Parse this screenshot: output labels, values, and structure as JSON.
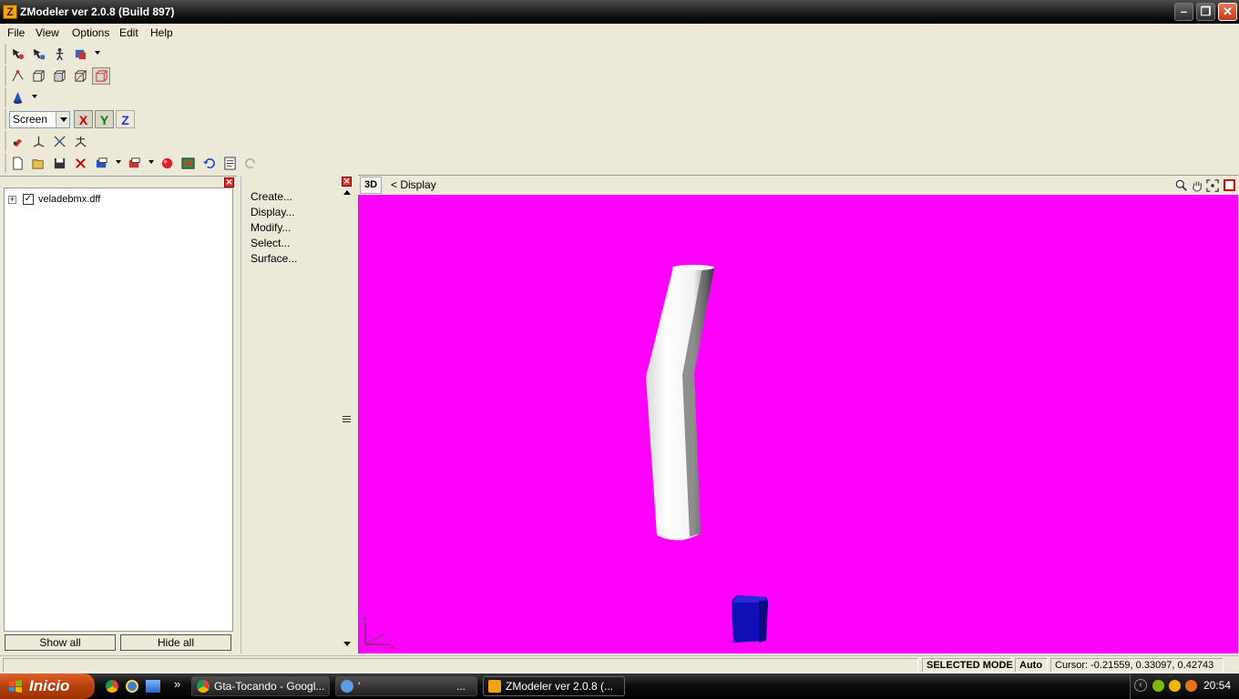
{
  "window": {
    "title": "ZModeler ver 2.0.8 (Build 897)",
    "logo_letter": "Z"
  },
  "menu": [
    "File",
    "View",
    "Options",
    "Edit",
    "Help"
  ],
  "toolbar": {
    "coord_select": "Screen",
    "axis_x": "X",
    "axis_y": "Y",
    "axis_z": "Z"
  },
  "tree": {
    "item": "veladebmx.dff",
    "checked": "✓",
    "expand": "+"
  },
  "left_buttons": {
    "show_all": "Show all",
    "hide_all": "Hide all"
  },
  "commands": [
    "Create...",
    "Display...",
    "Modify...",
    "Select...",
    "Surface..."
  ],
  "viewport": {
    "mode": "3D",
    "breadcrumb": "< Display",
    "background": "#ff00ff",
    "axis_y": "y",
    "axis_x": "x"
  },
  "status": {
    "mode": "SELECTED MODE",
    "auto": "Auto",
    "cursor": "Cursor: -0.21559, 0.33097, 0.42743"
  },
  "taskbar": {
    "start": "Inicio",
    "more": "»",
    "tasks": [
      "Gta-Tocando - Googl...",
      "'",
      "...",
      "ZModeler ver 2.0.8 (..."
    ],
    "clock": "20:54"
  }
}
